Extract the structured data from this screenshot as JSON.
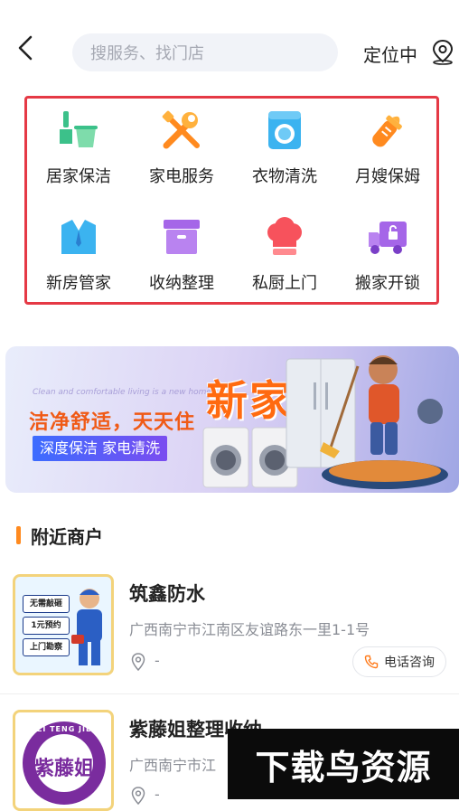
{
  "header": {
    "search_placeholder": "搜服务、找门店",
    "location_label": "定位中"
  },
  "categories": [
    {
      "label": "居家保洁",
      "icon": "cleaning-icon"
    },
    {
      "label": "家电服务",
      "icon": "tools-icon"
    },
    {
      "label": "衣物清洗",
      "icon": "washing-machine-icon"
    },
    {
      "label": "月嫂保姆",
      "icon": "baby-bottle-icon"
    },
    {
      "label": "新房管家",
      "icon": "shirt-icon"
    },
    {
      "label": "收纳整理",
      "icon": "storage-box-icon"
    },
    {
      "label": "私厨上门",
      "icon": "chef-hat-icon"
    },
    {
      "label": "搬家开锁",
      "icon": "moving-truck-icon"
    }
  ],
  "banner": {
    "line1": "洁净舒适，天天住",
    "line2": "深度保洁  家电清洗",
    "big_text": "新家",
    "script_text": "Clean and comfortable living is a new home"
  },
  "section": {
    "title": "附近商户"
  },
  "merchants": [
    {
      "name": "筑鑫防水",
      "address": "广西南宁市江南区友谊路东一里1-1号",
      "distance": "-",
      "call_label": "电话咨询",
      "tags": [
        "无需敲砸",
        "1元预约",
        "上门勘察"
      ]
    },
    {
      "name": "紫藤姐整理收纳",
      "address": "广西南宁市江",
      "distance": "-",
      "logo_text": "紫藤姐",
      "logo_ring_text": "ZI TENG JIE"
    }
  ],
  "watermark": "下载鸟资源",
  "colors": {
    "highlight_border": "#e53945",
    "accent_orange": "#ff8a1f",
    "call_icon": "#ff7a1a"
  }
}
